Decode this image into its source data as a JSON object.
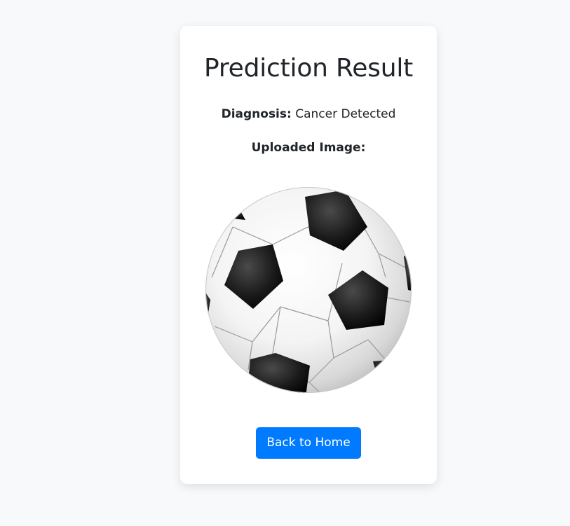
{
  "result": {
    "title": "Prediction Result",
    "diagnosis_label": "Diagnosis:",
    "diagnosis_value": "Cancer Detected",
    "uploaded_label": "Uploaded Image:",
    "image_subject": "soccer-ball",
    "back_button_label": "Back to Home"
  },
  "colors": {
    "page_background": "#f8f9fa",
    "card_background": "#ffffff",
    "text": "#212529",
    "button_background": "#007bff",
    "button_text": "#ffffff"
  }
}
